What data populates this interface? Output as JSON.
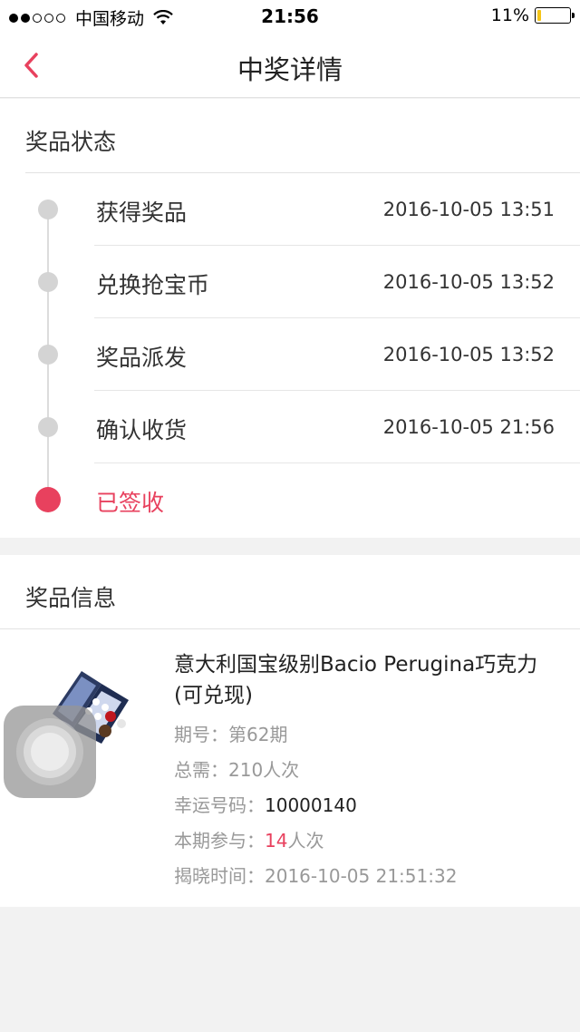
{
  "status_bar": {
    "signal_strength": "2/5",
    "carrier": "中国移动",
    "time": "21:56",
    "battery_percent": "11%",
    "battery_level": 0.11
  },
  "nav": {
    "title": "中奖详情"
  },
  "prize_status": {
    "header": "奖品状态",
    "steps": [
      {
        "label": "获得奖品",
        "time": "2016-10-05 13:51"
      },
      {
        "label": "兑换抢宝币",
        "time": "2016-10-05 13:52"
      },
      {
        "label": "奖品派发",
        "time": "2016-10-05 13:52"
      },
      {
        "label": "确认收货",
        "time": "2016-10-05 21:56"
      },
      {
        "label": "已签收",
        "time": ""
      }
    ]
  },
  "prize_info": {
    "header": "奖品信息",
    "product_name": "意大利国宝级别Bacio Perugina巧克力(可兑现)",
    "period_label": "期号：",
    "period_value": "第62期",
    "total_label": "总需：",
    "total_value": "210人次",
    "lucky_label": "幸运号码：",
    "lucky_value": "10000140",
    "participation_label": "本期参与：",
    "participation_count": "14",
    "participation_unit": "人次",
    "reveal_label": "揭晓时间：",
    "reveal_value": "2016-10-05 21:51:32"
  },
  "colors": {
    "accent": "#e8415e",
    "inactive_dot": "#d4d4d4"
  }
}
